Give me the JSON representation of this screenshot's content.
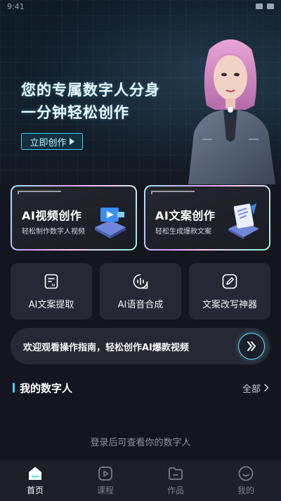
{
  "status_bar": {
    "time": "9:41"
  },
  "hero": {
    "title_line1": "您的专属数字人分身",
    "title_line2": "一分钟轻松创作",
    "cta_label": "立即创作"
  },
  "feature_cards": [
    {
      "title_prefix": "AI",
      "title_rest": "视频创作",
      "subtitle": "轻松制作数字人视频",
      "icon": "video-creation-icon"
    },
    {
      "title_prefix": "AI",
      "title_rest": "文案创作",
      "subtitle": "轻松生成爆款文案",
      "icon": "copywriting-icon"
    }
  ],
  "tools": [
    {
      "label": "AI文案提取",
      "icon": "text-extract-icon"
    },
    {
      "label": "AI语音合成",
      "icon": "voice-synthesis-icon"
    },
    {
      "label": "文案改写神器",
      "icon": "rewrite-icon"
    }
  ],
  "guide_banner": {
    "text": "欢迎观看操作指南，轻松创作AI爆款视频"
  },
  "my_avatars": {
    "title": "我的数字人",
    "more_label": "全部",
    "empty_text": "登录后可查看你的数字人"
  },
  "tabbar": [
    {
      "label": "首页",
      "icon": "home-icon",
      "active": true
    },
    {
      "label": "课程",
      "icon": "course-icon",
      "active": false
    },
    {
      "label": "作品",
      "icon": "works-icon",
      "active": false
    },
    {
      "label": "我的",
      "icon": "profile-icon",
      "active": false
    }
  ],
  "colors": {
    "accent": "#3ad7f0",
    "background": "#14161f",
    "card": "#262833",
    "tabbar": "#1d1f29"
  }
}
